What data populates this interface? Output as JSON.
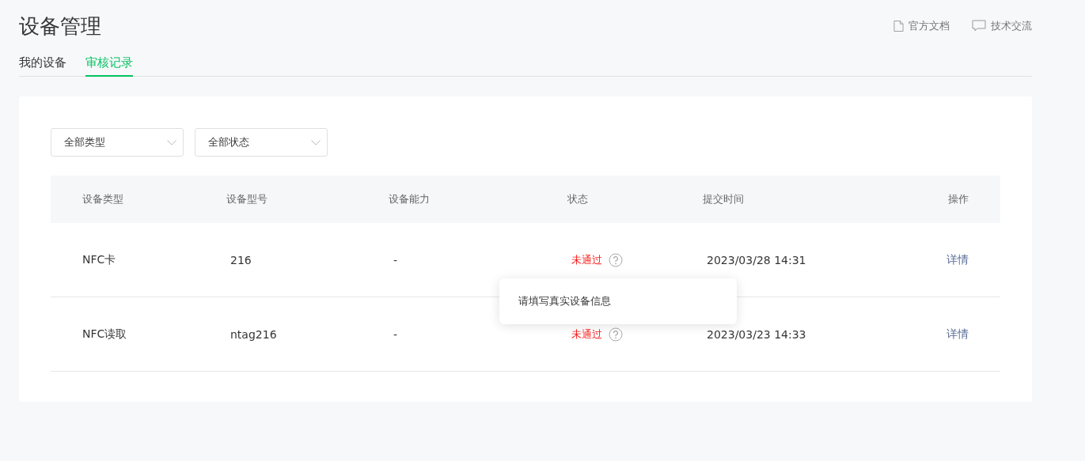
{
  "title": "设备管理",
  "links": [
    {
      "label": "官方文档"
    },
    {
      "label": "技术交流"
    }
  ],
  "tabs": [
    {
      "label": "我的设备",
      "selected": false
    },
    {
      "label": "审核记录",
      "selected": true
    }
  ],
  "filters": [
    {
      "value": "全部类型"
    },
    {
      "value": "全部状态"
    }
  ],
  "table": {
    "columns": [
      "设备类型",
      "设备型号",
      "设备能力",
      "状态",
      "提交时间",
      "操作"
    ],
    "rows": [
      {
        "type": "NFC卡",
        "model": "216",
        "capability": "-",
        "status": "未通过",
        "time": "2023/03/28 14:31",
        "action": "详情",
        "tooltip": "请填写真实设备信息"
      },
      {
        "type": "NFC读取",
        "model": "ntag216",
        "capability": "-",
        "status": "未通过",
        "time": "2023/03/23 14:33",
        "action": "详情"
      }
    ]
  }
}
